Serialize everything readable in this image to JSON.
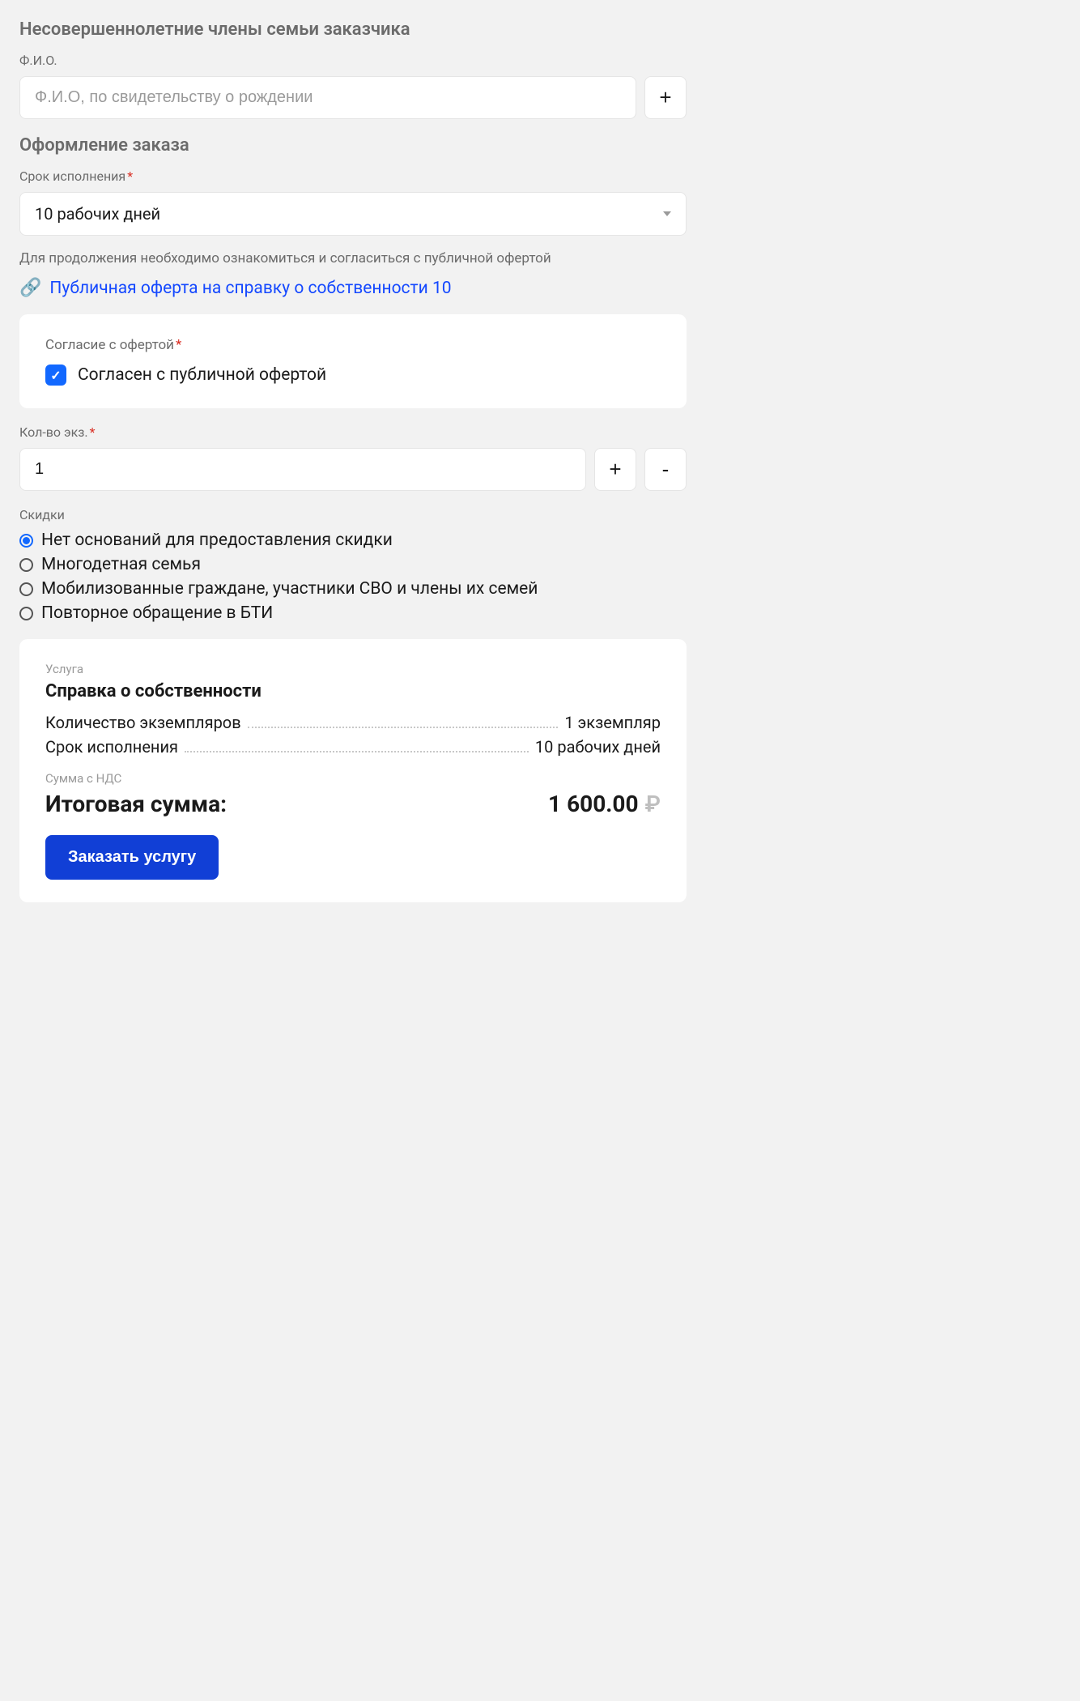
{
  "minors": {
    "title": "Несовершеннолетние члены семьи заказчика",
    "fio_label": "Ф.И.О.",
    "fio_placeholder": "Ф.И.О, по свидетельству о рождении",
    "add": "+"
  },
  "order": {
    "title": "Оформление заказа",
    "term_label": "Срок исполнения",
    "term_value": "10 рабочих дней",
    "offer_note": "Для продолжения необходимо ознакомиться и согласиться с публичной офертой",
    "offer_link": "Публичная оферта на справку о собственности 10",
    "consent_label": "Согласие с офертой",
    "consent_text": "Согласен с публичной офертой",
    "qty_label": "Кол-во экз.",
    "qty_value": "1",
    "plus": "+",
    "minus": "-"
  },
  "discounts": {
    "label": "Скидки",
    "options": [
      "Нет оснований для предоставления скидки",
      "Многодетная семья",
      "Мобилизованные граждане, участники СВО и члены их семей",
      "Повторное обращение в БТИ"
    ],
    "selected": 0
  },
  "summary": {
    "service_label": "Услуга",
    "service_name": "Справка о собственности",
    "rows": [
      {
        "k": "Количество экземпляров",
        "v": "1 экземпляр"
      },
      {
        "k": "Срок исполнения",
        "v": "10 рабочих дней"
      }
    ],
    "sum_label": "Сумма с НДС",
    "total_label": "Итоговая сумма:",
    "total_value": "1 600.00",
    "currency": "₽",
    "cta": "Заказать услугу"
  }
}
